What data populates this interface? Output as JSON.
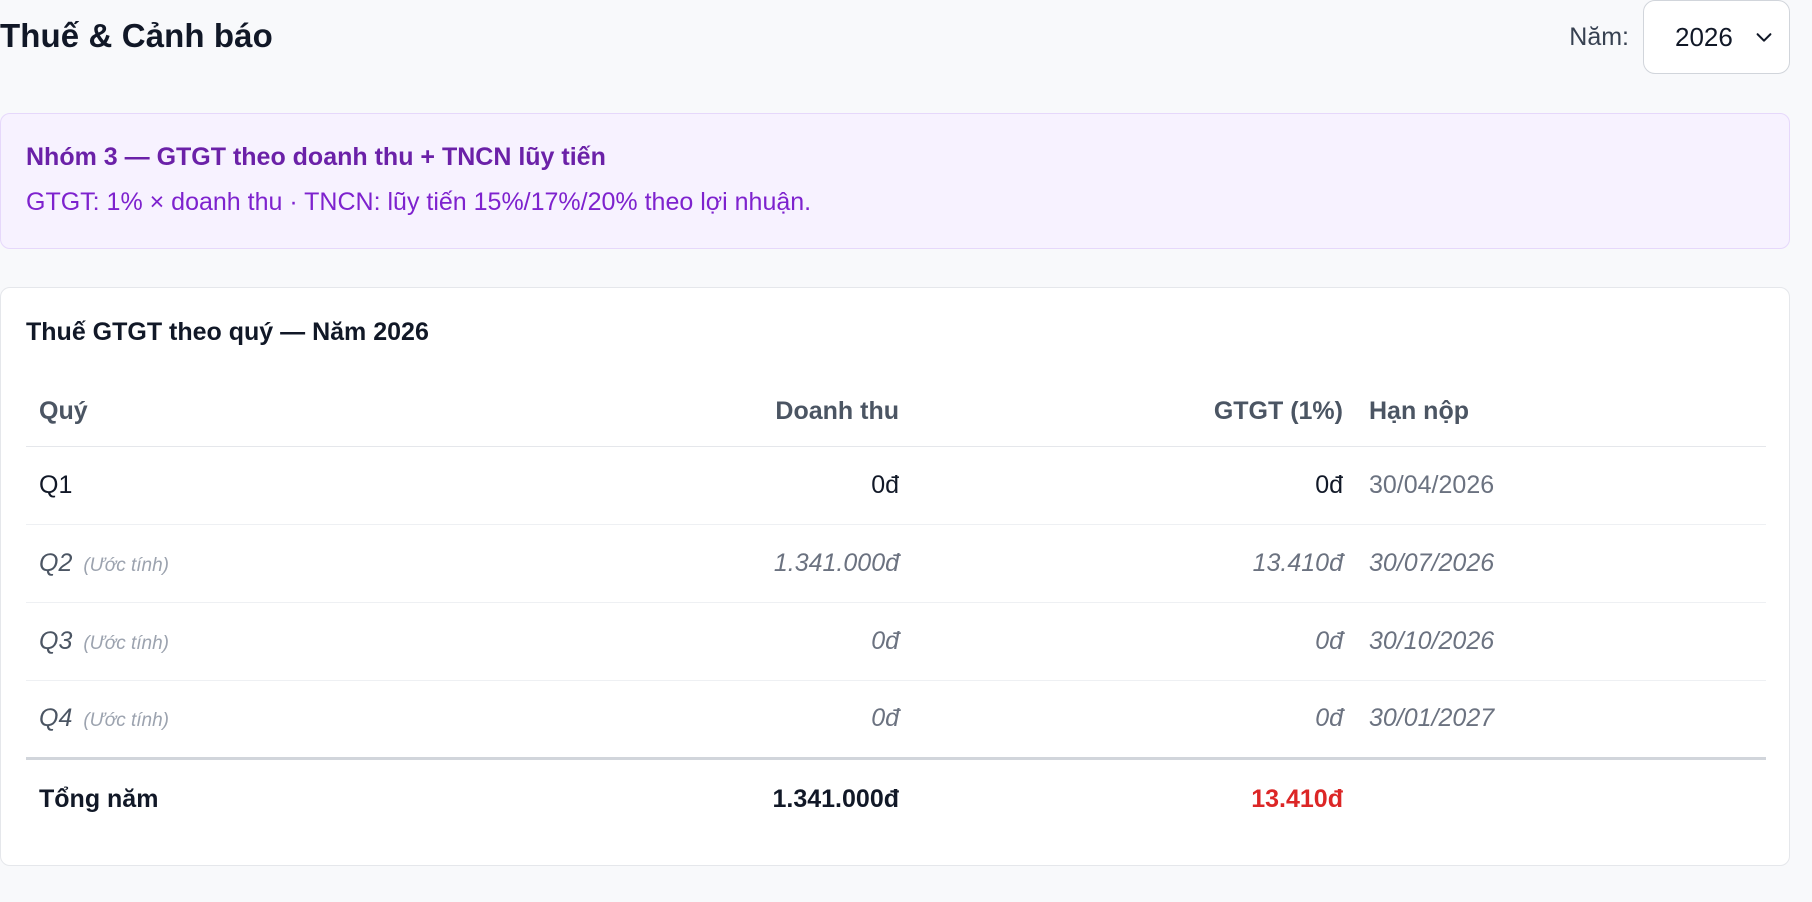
{
  "header": {
    "title": "Thuế & Cảnh báo",
    "year_label": "Năm:",
    "year_value": "2026"
  },
  "banner": {
    "title": "Nhóm 3 — GTGT theo doanh thu + TNCN lũy tiến",
    "description": "GTGT: 1% × doanh thu · TNCN: lũy tiến 15%/17%/20% theo lợi nhuận."
  },
  "vat_table": {
    "title": "Thuế GTGT theo quý — Năm 2026",
    "columns": {
      "quarter": "Quý",
      "revenue": "Doanh thu",
      "vat": "GTGT (1%)",
      "due": "Hạn nộp"
    },
    "rows": [
      {
        "quarter": "Q1",
        "tag": "",
        "revenue": "0đ",
        "vat": "0đ",
        "due": "30/04/2026"
      },
      {
        "quarter": "Q2",
        "tag": "(Ước tính)",
        "revenue": "1.341.000đ",
        "vat": "13.410đ",
        "due": "30/07/2026"
      },
      {
        "quarter": "Q3",
        "tag": "(Ước tính)",
        "revenue": "0đ",
        "vat": "0đ",
        "due": "30/10/2026"
      },
      {
        "quarter": "Q4",
        "tag": "(Ước tính)",
        "revenue": "0đ",
        "vat": "0đ",
        "due": "30/01/2027"
      }
    ],
    "total": {
      "label": "Tổng năm",
      "revenue": "1.341.000đ",
      "vat": "13.410đ"
    }
  },
  "colors": {
    "accent_purple": "#6b21a8",
    "banner_bg": "#f7f2ff",
    "total_vat_red": "#dc2626"
  },
  "icons": {
    "year_dropdown": "chevron-down-icon"
  }
}
